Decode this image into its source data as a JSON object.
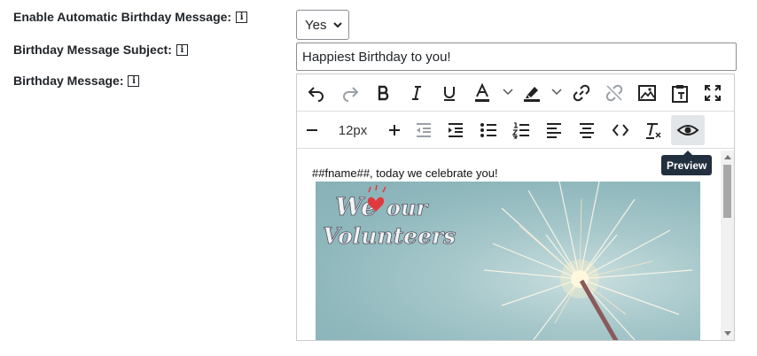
{
  "form": {
    "enable_label": "Enable Automatic Birthday Message:",
    "subject_label": "Birthday Message Subject:",
    "message_label": "Birthday Message:",
    "enable_value": "Yes",
    "subject_value": "Happiest Birthday to you!"
  },
  "icons": {
    "info": "info-icon",
    "info_glyph": "i"
  },
  "editor": {
    "toolbar_row1": [
      "undo",
      "redo",
      "bold",
      "italic",
      "underline",
      "text-color",
      "highlight-color",
      "link",
      "unlink",
      "image",
      "paste-as-text",
      "fullscreen"
    ],
    "toolbar_row2": [
      "decrease-font-size",
      "font-size",
      "increase-font-size",
      "outdent",
      "indent",
      "bullet-list",
      "numbered-list",
      "align-left",
      "align-center",
      "source-code",
      "clear-formatting",
      "preview"
    ],
    "font_size": "12px",
    "tooltip": "Preview",
    "content_text": "##fname##, today we celebrate you!",
    "banner": {
      "line1": "We",
      "line1b": "our",
      "line2": "Volunteers"
    }
  },
  "colors": {
    "accent_heart": "#e03a3e",
    "banner_bg": "#8fb8bd",
    "tooltip_bg": "#222f3e"
  }
}
